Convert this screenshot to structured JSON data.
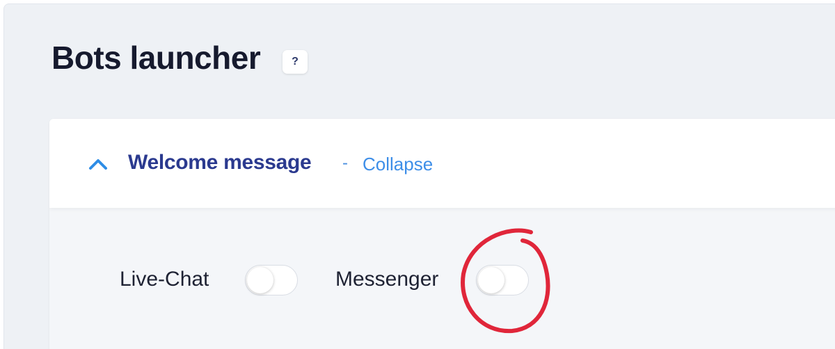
{
  "page": {
    "title": "Bots launcher",
    "help_label": "?"
  },
  "section": {
    "title": "Welcome message",
    "separator": "-",
    "collapse_label": "Collapse"
  },
  "toggles": [
    {
      "label": "Live-Chat",
      "enabled": false
    },
    {
      "label": "Messenger",
      "enabled": false
    }
  ],
  "icons": {
    "chevron": "chevron-up-icon",
    "help": "question-mark-icon"
  },
  "colors": {
    "title_text": "#161a2e",
    "section_title": "#2b3a8f",
    "link": "#3d8ee8",
    "background": "#eef1f5",
    "annotation": "#e0263a"
  }
}
